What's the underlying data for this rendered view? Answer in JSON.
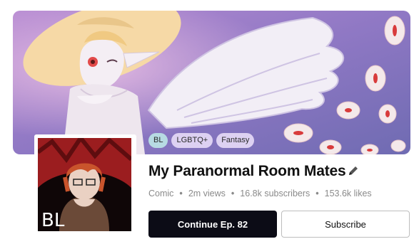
{
  "tags": [
    "BL",
    "LGBTQ+",
    "Fantasy"
  ],
  "cover": {
    "badge": "BL"
  },
  "series": {
    "title": "My Paranormal Room Mates",
    "edit_icon": "pencil-icon"
  },
  "stats": {
    "genre": "Comic",
    "views": "2m views",
    "subscribers": "16.8k subscribers",
    "likes": "153.6k likes"
  },
  "actions": {
    "continue_label": "Continue Ep. 82",
    "subscribe_label": "Subscribe"
  },
  "colors": {
    "primary_button": "#0c0c16",
    "tag_bl": "#b7dbe3",
    "tag_genre": "#ddd1f2"
  }
}
